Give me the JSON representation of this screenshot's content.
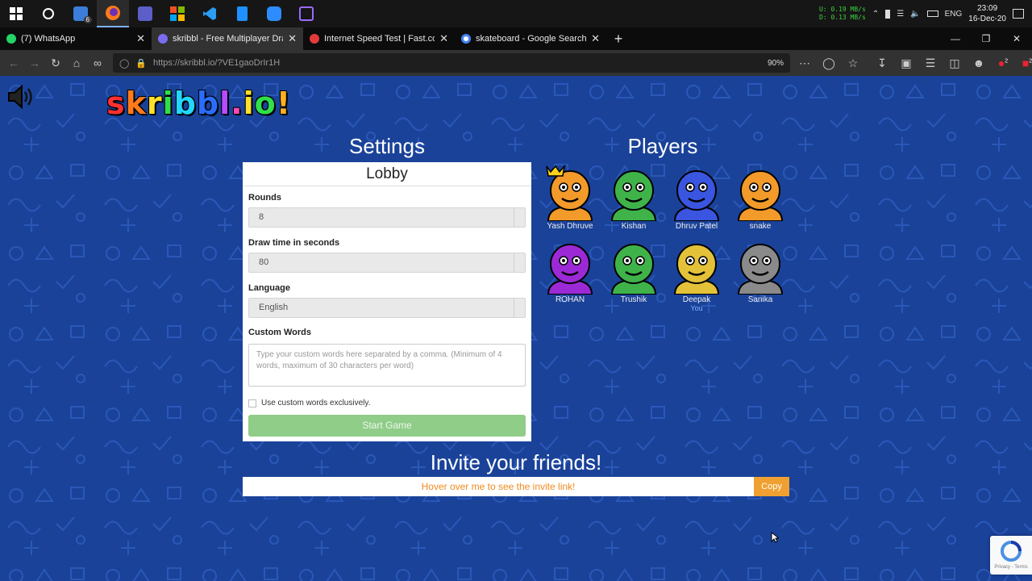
{
  "taskbar": {
    "mail_badge": "6",
    "net_up": "0.19 MB/s",
    "net_down": "0.13 MB/s",
    "net_up_label": "U:",
    "net_down_label": "D:",
    "language": "ENG",
    "time": "23:09",
    "date": "16-Dec-20"
  },
  "browser": {
    "tabs": [
      {
        "title": "(7) WhatsApp",
        "favicon_color": "#25d366"
      },
      {
        "title": "skribbl - Free Multiplayer Drawing",
        "favicon_color": "#7a6df0"
      },
      {
        "title": "Internet Speed Test | Fast.com",
        "favicon_color": "#e23b3b"
      },
      {
        "title": "skateboard - Google Search",
        "favicon_color": "#ffffff"
      }
    ],
    "url": "https://skribbl.io/?VE1gaoDrIr1H",
    "zoom": "90%",
    "badge_a": "2",
    "badge_b": "2"
  },
  "page": {
    "logo": [
      "s",
      "k",
      "r",
      "i",
      "b",
      "b",
      "l",
      ".",
      "i",
      "o",
      "!"
    ],
    "logo_colors": [
      "#ff3030",
      "#ff7a1a",
      "#ffe02a",
      "#2fe04a",
      "#23d6ff",
      "#2a6dff",
      "#b84cff",
      "#ff49b4",
      "#ffe02a",
      "#2fe04a",
      "#ffb020"
    ],
    "settings_heading": "Settings",
    "players_heading": "Players",
    "panel_title": "Lobby",
    "rounds_label": "Rounds",
    "rounds_value": "8",
    "drawtime_label": "Draw time in seconds",
    "drawtime_value": "80",
    "language_label": "Language",
    "language_value": "English",
    "custom_words_label": "Custom Words",
    "custom_words_placeholder": "Type your custom words here separated by a comma. (Minimum of 4 words, maximum of 30 characters per word)",
    "exclusive_label": "Use custom words exclusively.",
    "start_button": "Start Game",
    "invite_heading": "Invite your friends!",
    "invite_hover": "Hover over me to see the invite link!",
    "copy_button": "Copy",
    "recaptcha_text": "Privacy - Terms"
  },
  "players": [
    {
      "name": "Yash Dhruve",
      "color": "#f29a2a",
      "owner": true
    },
    {
      "name": "Kishan",
      "color": "#3fb34a"
    },
    {
      "name": "Dhruv Patel",
      "color": "#3a55e0"
    },
    {
      "name": "snake",
      "color": "#f29a2a"
    },
    {
      "name": "ROHAN",
      "color": "#9b2ad6"
    },
    {
      "name": "Trushik",
      "color": "#3fb34a"
    },
    {
      "name": "Deepak",
      "color": "#e3c23a",
      "you": "You"
    },
    {
      "name": "Sanika",
      "color": "#8a8a8a"
    }
  ]
}
